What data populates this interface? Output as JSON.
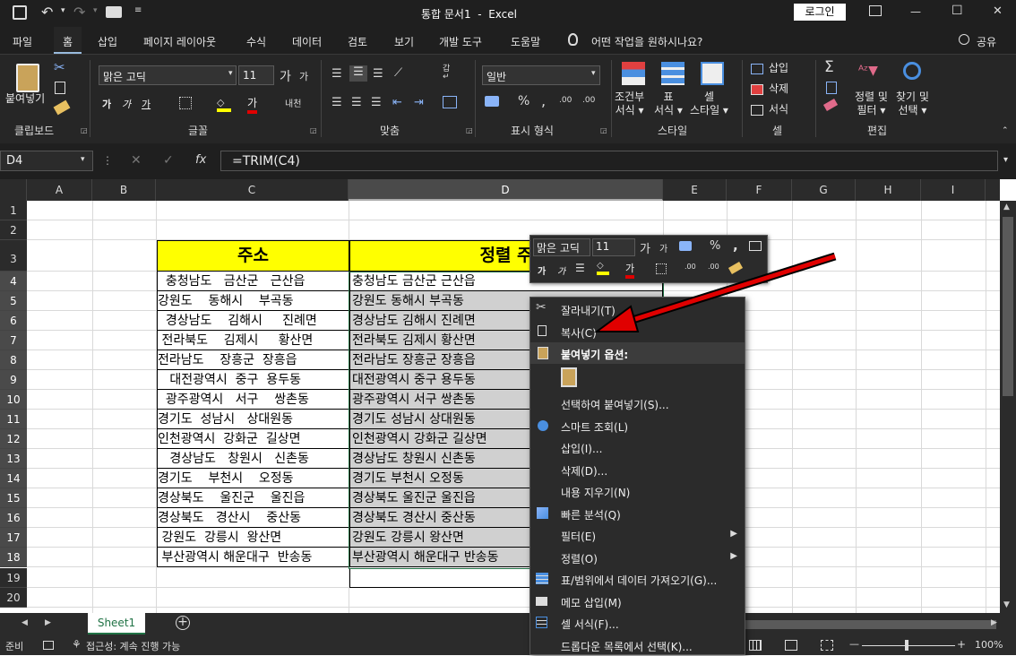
{
  "title_bar": {
    "title": "통합 문서1  -  Excel",
    "login": "로그인",
    "minimize": "—",
    "restore": "☐",
    "close": "✕"
  },
  "tabs": [
    "파일",
    "홈",
    "삽입",
    "페이지 레이아웃",
    "수식",
    "데이터",
    "검토",
    "보기",
    "개발 도구",
    "도움말"
  ],
  "tell_me": "어떤 작업을 원하시나요?",
  "share": "공유",
  "ribbon": {
    "paste": "붙여넣기",
    "clipboard": "클립보드",
    "font_name": "맑은 고딕",
    "font_size": "11",
    "font": "글꼴",
    "align": "맞춤",
    "number_format": "일반",
    "number": "표시 형식",
    "cond_format": "조건부\n서식 ▾",
    "table": "표\n서식 ▾",
    "cell_style": "셀\n스타일 ▾",
    "style": "스타일",
    "insert": "삽입",
    "delete": "삭제",
    "format": "서식",
    "cells": "셀",
    "sort_filter": "정렬 및\n필터 ▾",
    "find_select": "찾기 및\n선택 ▾",
    "editing": "편집",
    "wrap_label": "자동줄바꿈",
    "bold": "가",
    "italic": "가",
    "underline": "가",
    "font_color_label": "가"
  },
  "formula_bar": {
    "name_box": "D4",
    "cancel": "✕",
    "enter": "✓",
    "fx": "fx",
    "formula": "=TRIM(C4)"
  },
  "columns": [
    "A",
    "B",
    "C",
    "D",
    "E",
    "F",
    "G",
    "H",
    "I"
  ],
  "rows": [
    "1",
    "2",
    "3",
    "4",
    "5",
    "6",
    "7",
    "8",
    "9",
    "10",
    "11",
    "12",
    "13",
    "14",
    "15",
    "16",
    "17",
    "18",
    "19",
    "20"
  ],
  "header_c": "주소",
  "header_d": "정렬 주",
  "col_c": [
    "  충청남도   금산군   근산읍",
    "강원도    동해시    부곡동",
    "  경상남도    김해시     진례면",
    " 전라북도    김제시     황산면",
    "전라남도    장흥군  장흥읍",
    "   대전광역시  중구  용두동",
    "  광주광역시   서구    쌍촌동",
    "경기도  성남시   상대원동",
    "인천광역시  강화군  길상면",
    "   경상남도   창원시   신촌동",
    "경기도    부천시    오정동",
    "경상북도    울진군    울진읍",
    "경상북도   경산시    중산동",
    " 강원도  강릉시  왕산면",
    " 부산광역시 해운대구  반송동"
  ],
  "col_d": [
    "충청남도 금산군 근산읍",
    "강원도 동해시 부곡동",
    "경상남도 김해시 진례면",
    "전라북도 김제시 황산면",
    "전라남도 장흥군 장흥읍",
    "대전광역시 중구 용두동",
    "광주광역시 서구 쌍촌동",
    "경기도 성남시 상대원동",
    "인천광역시 강화군 길상면",
    "경상남도 창원시 신촌동",
    "경기도 부천시 오정동",
    "경상북도 울진군 울진읍",
    "경상북도 경산시 중산동",
    "강원도 강릉시 왕산면",
    "부산광역시 해운대구 반송동"
  ],
  "mini_toolbar": {
    "font": "맑은 고딕",
    "size": "11",
    "percent": "%",
    "comma": ","
  },
  "context_menu": {
    "items": [
      {
        "label": "잘라내기(T)",
        "icon": "scissors-icon"
      },
      {
        "label": "복사(C)",
        "icon": "copy-icon"
      },
      {
        "label": "붙여넣기 옵션:",
        "icon": "clipboard-icon",
        "header": true
      },
      {
        "label": "",
        "icon": "paste-icon",
        "paste_option": true
      },
      {
        "label": "선택하여 붙여넣기(S)...",
        "icon": ""
      },
      {
        "label": "스마트 조회(L)",
        "icon": "info-icon"
      },
      {
        "label": "삽입(I)...",
        "icon": ""
      },
      {
        "label": "삭제(D)...",
        "icon": ""
      },
      {
        "label": "내용 지우기(N)",
        "icon": ""
      },
      {
        "label": "빠른 분석(Q)",
        "icon": "quick-analysis-icon"
      },
      {
        "label": "필터(E)",
        "icon": "",
        "submenu": true
      },
      {
        "label": "정렬(O)",
        "icon": "",
        "submenu": true
      },
      {
        "label": "표/범위에서 데이터 가져오기(G)...",
        "icon": "table-icon"
      },
      {
        "label": "메모 삽입(M)",
        "icon": "comment-icon"
      },
      {
        "label": "셀 서식(F)...",
        "icon": "format-cells-icon"
      },
      {
        "label": "드롭다운 목록에서 선택(K)...",
        "icon": ""
      }
    ]
  },
  "sheet_tab": "Sheet1",
  "status": {
    "ready": "준비",
    "accessibility": "접근성: 계속 진행 가능",
    "zoom": "100%",
    "zoom_minus": "—",
    "zoom_plus": "+"
  },
  "colors": {
    "accent": "#e00000",
    "selection": "#d0d0d0",
    "header_fill": "#ffff00",
    "tab_green": "#2e7d32"
  }
}
